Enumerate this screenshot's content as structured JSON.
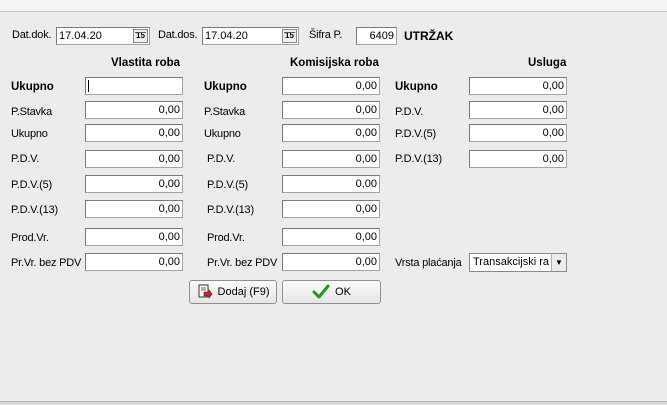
{
  "header": {
    "dat_dok_label": "Dat.dok.",
    "dat_dok_value": "17.04.20",
    "dat_dos_label": "Dat.dos.",
    "dat_dos_value": "17.04.20",
    "date_btn_text": "15",
    "sifra_label": "Šifra P.",
    "sifra_value": "6409",
    "type_label": "UTRŽAK"
  },
  "sections": {
    "vlastita": "Vlastita roba",
    "komisijska": "Komisijska roba",
    "usluga": "Usluga"
  },
  "vlastita": {
    "ukupno_label": "Ukupno",
    "ukupno_value": "",
    "pstavka_label": "P.Stavka",
    "pstavka_value": "0,00",
    "ukupno2_label": "Ukupno",
    "ukupno2_value": "0,00",
    "pdv_label": "P.D.V.",
    "pdv_value": "0,00",
    "pdv5_label": "P.D.V.(5)",
    "pdv5_value": "0,00",
    "pdv13_label": "P.D.V.(13)",
    "pdv13_value": "0,00",
    "prodvr_label": "Prod.Vr.",
    "prodvr_value": "0,00",
    "prvr_label": "Pr.Vr. bez PDV",
    "prvr_value": "0,00"
  },
  "komisijska": {
    "ukupno_label": "Ukupno",
    "ukupno_value": "0,00",
    "pstavka_label": "P.Stavka",
    "pstavka_value": "0,00",
    "ukupno2_label": "Ukupno",
    "ukupno2_value": "0,00",
    "pdv_label": "P.D.V.",
    "pdv_value": "0,00",
    "pdv5_label": "P.D.V.(5)",
    "pdv5_value": "0,00",
    "pdv13_label": "P.D.V.(13)",
    "pdv13_value": "0,00",
    "prodvr_label": "Prod.Vr.",
    "prodvr_value": "0,00",
    "prvr_label": "Pr.Vr. bez PDV",
    "prvr_value": "0,00"
  },
  "usluga": {
    "ukupno_label": "Ukupno",
    "ukupno_value": "0,00",
    "pdv_label": "P.D.V.",
    "pdv_value": "0,00",
    "pdv5_label": "P.D.V.(5)",
    "pdv5_value": "0,00",
    "pdv13_label": "P.D.V.(13)",
    "pdv13_value": "0,00",
    "vrsta_label": "Vrsta plaćanja",
    "vrsta_value": "Transakcijski ra"
  },
  "buttons": {
    "dodaj_label": "Dodaj (F9)",
    "ok_label": "OK"
  },
  "colors": {
    "background": "#ececec",
    "ok_icon": "#1f9a1f",
    "dodaj_icon": "#d22020"
  }
}
